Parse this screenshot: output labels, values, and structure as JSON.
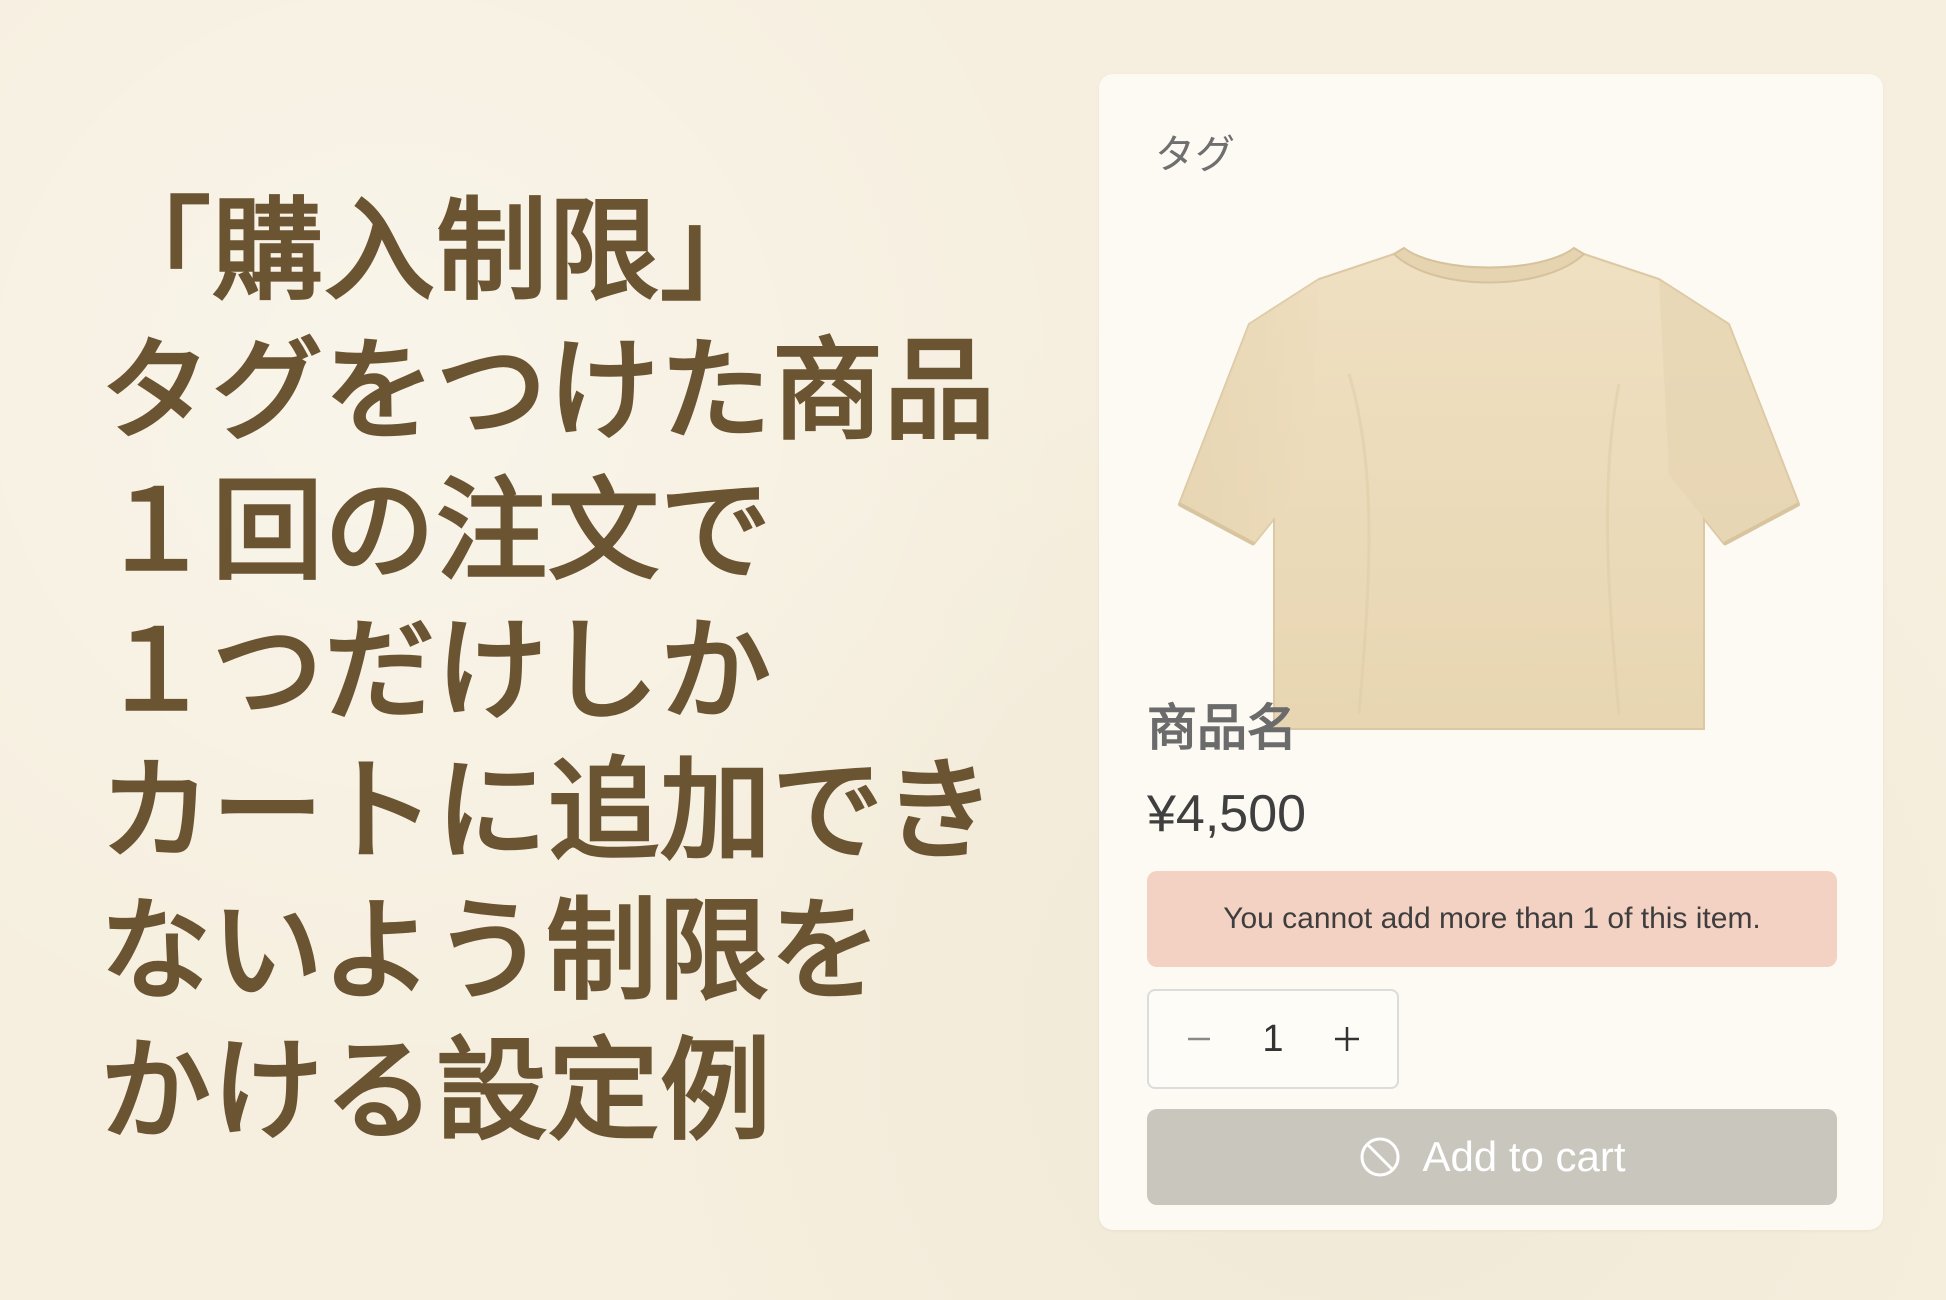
{
  "headline": {
    "lines": [
      "「購入制限」",
      "タグをつけた商品",
      "１回の注文で",
      "１つだけしか",
      "カートに追加でき",
      "ないよう制限を",
      "かける設定例"
    ]
  },
  "card": {
    "tag_label": "タグ",
    "product_name": "商品名",
    "price": "¥4,500",
    "alert_message": "You cannot add more than 1 of this item.",
    "quantity": "1",
    "add_to_cart_label": "Add to cart",
    "disabled_icon": "disabled-icon"
  },
  "colors": {
    "background": "#f6efdf",
    "headline": "#6b5431",
    "alert_bg": "#f3d2c3",
    "button_disabled": "#c9c7bd",
    "shirt": "#ecdcbb"
  }
}
